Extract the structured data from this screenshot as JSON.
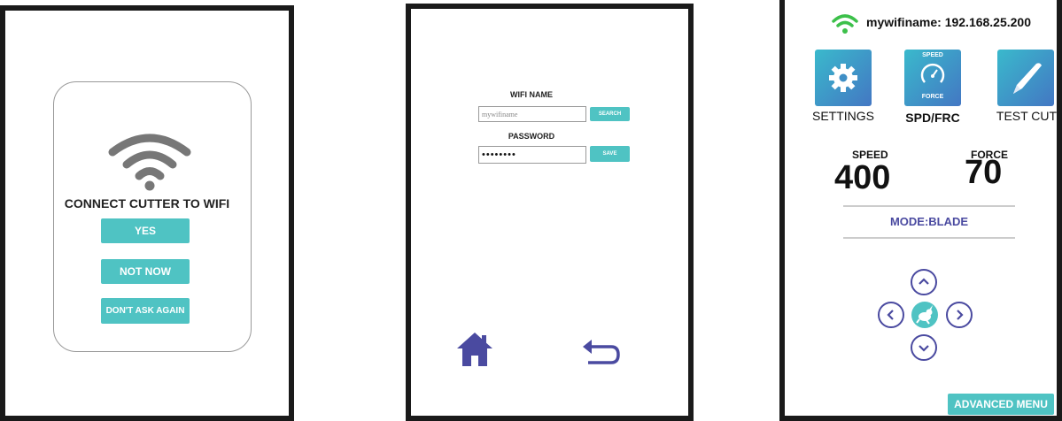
{
  "screen1": {
    "title": "CONNECT CUTTER TO WIFI",
    "buttons": [
      "YES",
      "NOT NOW",
      "DON'T ASK AGAIN"
    ]
  },
  "screen2": {
    "wifi_label": "WIFI NAME",
    "wifi_value": "mywifiname",
    "search_label": "SEARCH",
    "password_label": "PASSWORD",
    "password_value": "••••••••",
    "save_label": "SAVE"
  },
  "screen3": {
    "header": "mywifiname: 192.168.25.200",
    "tiles": {
      "settings": "SETTINGS",
      "spdfrc": "SPD/FRC",
      "testcut": "TEST CUT",
      "gauge_top": "SPEED",
      "gauge_bottom": "FORCE"
    },
    "speed_label": "SPEED",
    "speed_value": "400",
    "force_label": "FORCE",
    "force_value": "70",
    "mode_text": "MODE:BLADE",
    "advanced_label": "ADVANCED MENU"
  },
  "colors": {
    "teal": "#4fc3c3",
    "indigo": "#4a4aa0",
    "wifi_green": "#3cc04a"
  },
  "icons": [
    "wifi-icon",
    "home-icon",
    "back-arrow-icon",
    "gear-icon",
    "gauge-icon",
    "pen-icon",
    "chevron-up-icon",
    "chevron-down-icon",
    "chevron-left-icon",
    "chevron-right-icon",
    "rabbit-icon"
  ]
}
